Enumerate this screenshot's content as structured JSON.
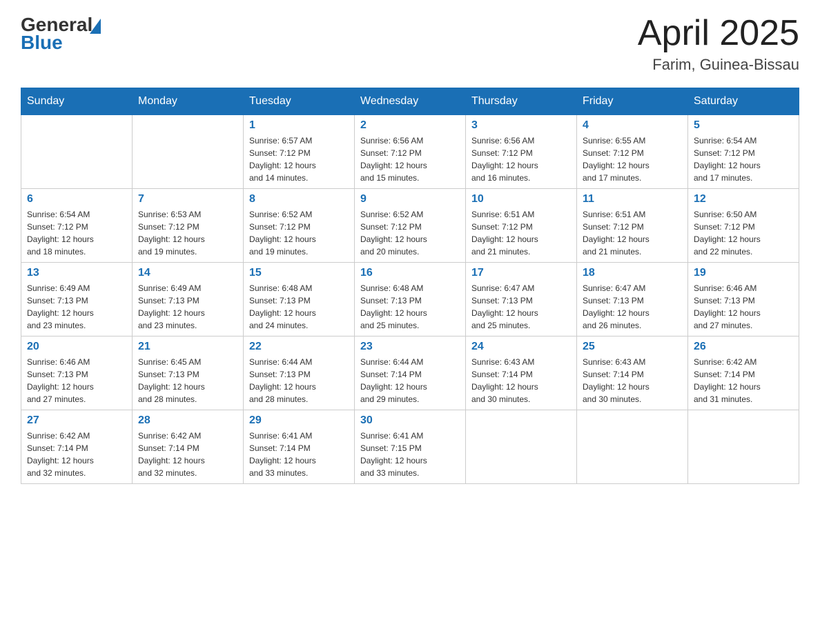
{
  "header": {
    "logo_general": "General",
    "logo_blue": "Blue",
    "title": "April 2025",
    "subtitle": "Farim, Guinea-Bissau"
  },
  "days_of_week": [
    "Sunday",
    "Monday",
    "Tuesday",
    "Wednesday",
    "Thursday",
    "Friday",
    "Saturday"
  ],
  "weeks": [
    [
      {
        "day": "",
        "info": ""
      },
      {
        "day": "",
        "info": ""
      },
      {
        "day": "1",
        "info": "Sunrise: 6:57 AM\nSunset: 7:12 PM\nDaylight: 12 hours\nand 14 minutes."
      },
      {
        "day": "2",
        "info": "Sunrise: 6:56 AM\nSunset: 7:12 PM\nDaylight: 12 hours\nand 15 minutes."
      },
      {
        "day": "3",
        "info": "Sunrise: 6:56 AM\nSunset: 7:12 PM\nDaylight: 12 hours\nand 16 minutes."
      },
      {
        "day": "4",
        "info": "Sunrise: 6:55 AM\nSunset: 7:12 PM\nDaylight: 12 hours\nand 17 minutes."
      },
      {
        "day": "5",
        "info": "Sunrise: 6:54 AM\nSunset: 7:12 PM\nDaylight: 12 hours\nand 17 minutes."
      }
    ],
    [
      {
        "day": "6",
        "info": "Sunrise: 6:54 AM\nSunset: 7:12 PM\nDaylight: 12 hours\nand 18 minutes."
      },
      {
        "day": "7",
        "info": "Sunrise: 6:53 AM\nSunset: 7:12 PM\nDaylight: 12 hours\nand 19 minutes."
      },
      {
        "day": "8",
        "info": "Sunrise: 6:52 AM\nSunset: 7:12 PM\nDaylight: 12 hours\nand 19 minutes."
      },
      {
        "day": "9",
        "info": "Sunrise: 6:52 AM\nSunset: 7:12 PM\nDaylight: 12 hours\nand 20 minutes."
      },
      {
        "day": "10",
        "info": "Sunrise: 6:51 AM\nSunset: 7:12 PM\nDaylight: 12 hours\nand 21 minutes."
      },
      {
        "day": "11",
        "info": "Sunrise: 6:51 AM\nSunset: 7:12 PM\nDaylight: 12 hours\nand 21 minutes."
      },
      {
        "day": "12",
        "info": "Sunrise: 6:50 AM\nSunset: 7:12 PM\nDaylight: 12 hours\nand 22 minutes."
      }
    ],
    [
      {
        "day": "13",
        "info": "Sunrise: 6:49 AM\nSunset: 7:13 PM\nDaylight: 12 hours\nand 23 minutes."
      },
      {
        "day": "14",
        "info": "Sunrise: 6:49 AM\nSunset: 7:13 PM\nDaylight: 12 hours\nand 23 minutes."
      },
      {
        "day": "15",
        "info": "Sunrise: 6:48 AM\nSunset: 7:13 PM\nDaylight: 12 hours\nand 24 minutes."
      },
      {
        "day": "16",
        "info": "Sunrise: 6:48 AM\nSunset: 7:13 PM\nDaylight: 12 hours\nand 25 minutes."
      },
      {
        "day": "17",
        "info": "Sunrise: 6:47 AM\nSunset: 7:13 PM\nDaylight: 12 hours\nand 25 minutes."
      },
      {
        "day": "18",
        "info": "Sunrise: 6:47 AM\nSunset: 7:13 PM\nDaylight: 12 hours\nand 26 minutes."
      },
      {
        "day": "19",
        "info": "Sunrise: 6:46 AM\nSunset: 7:13 PM\nDaylight: 12 hours\nand 27 minutes."
      }
    ],
    [
      {
        "day": "20",
        "info": "Sunrise: 6:46 AM\nSunset: 7:13 PM\nDaylight: 12 hours\nand 27 minutes."
      },
      {
        "day": "21",
        "info": "Sunrise: 6:45 AM\nSunset: 7:13 PM\nDaylight: 12 hours\nand 28 minutes."
      },
      {
        "day": "22",
        "info": "Sunrise: 6:44 AM\nSunset: 7:13 PM\nDaylight: 12 hours\nand 28 minutes."
      },
      {
        "day": "23",
        "info": "Sunrise: 6:44 AM\nSunset: 7:14 PM\nDaylight: 12 hours\nand 29 minutes."
      },
      {
        "day": "24",
        "info": "Sunrise: 6:43 AM\nSunset: 7:14 PM\nDaylight: 12 hours\nand 30 minutes."
      },
      {
        "day": "25",
        "info": "Sunrise: 6:43 AM\nSunset: 7:14 PM\nDaylight: 12 hours\nand 30 minutes."
      },
      {
        "day": "26",
        "info": "Sunrise: 6:42 AM\nSunset: 7:14 PM\nDaylight: 12 hours\nand 31 minutes."
      }
    ],
    [
      {
        "day": "27",
        "info": "Sunrise: 6:42 AM\nSunset: 7:14 PM\nDaylight: 12 hours\nand 32 minutes."
      },
      {
        "day": "28",
        "info": "Sunrise: 6:42 AM\nSunset: 7:14 PM\nDaylight: 12 hours\nand 32 minutes."
      },
      {
        "day": "29",
        "info": "Sunrise: 6:41 AM\nSunset: 7:14 PM\nDaylight: 12 hours\nand 33 minutes."
      },
      {
        "day": "30",
        "info": "Sunrise: 6:41 AM\nSunset: 7:15 PM\nDaylight: 12 hours\nand 33 minutes."
      },
      {
        "day": "",
        "info": ""
      },
      {
        "day": "",
        "info": ""
      },
      {
        "day": "",
        "info": ""
      }
    ]
  ]
}
